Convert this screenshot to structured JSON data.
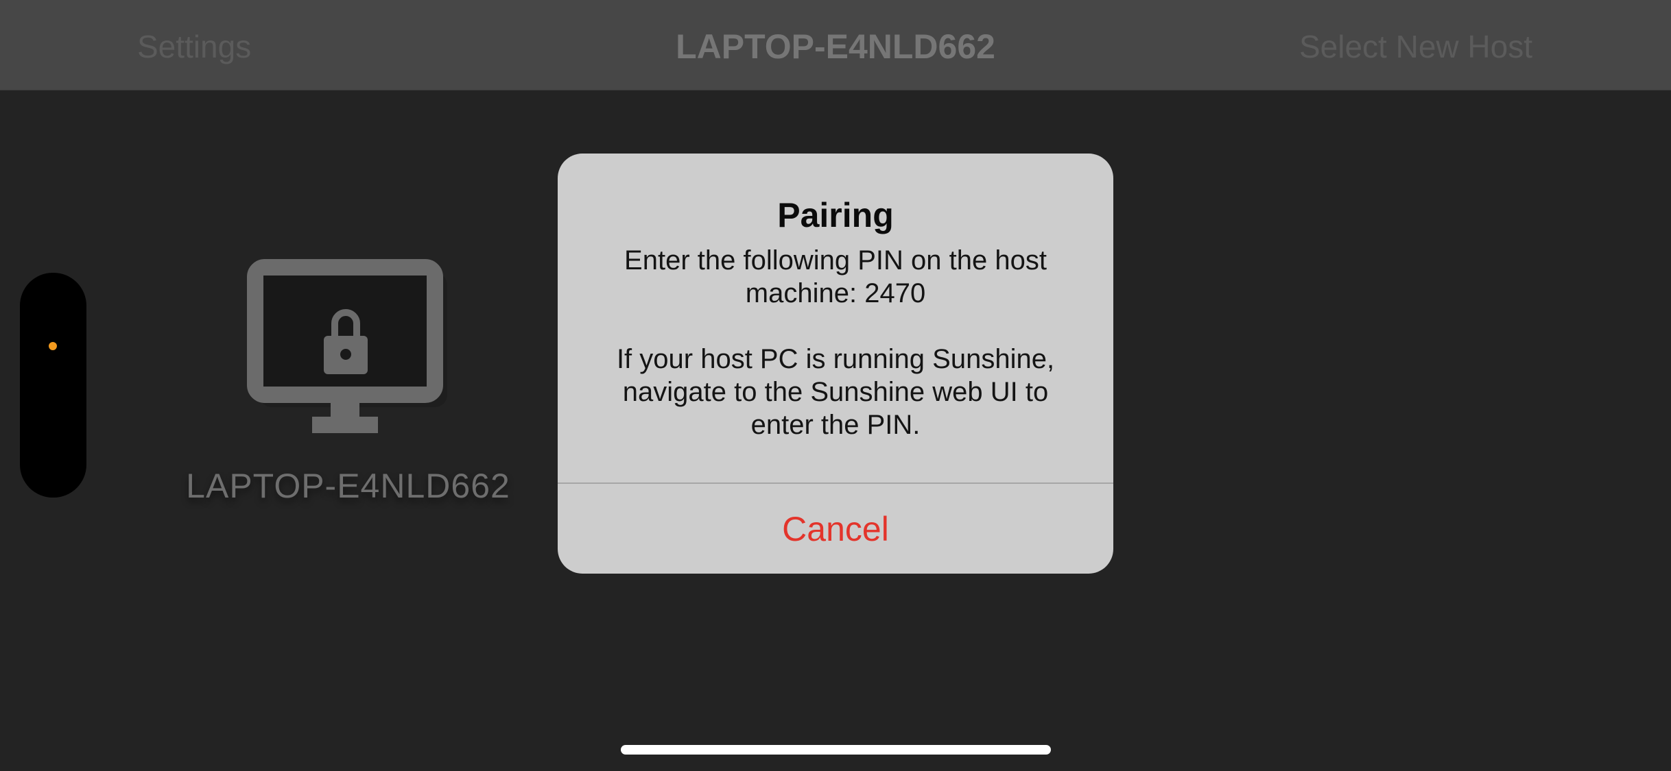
{
  "navbar": {
    "left_label": "Settings",
    "title": "LAPTOP-E4NLD662",
    "right_label": "Select New Host"
  },
  "host": {
    "name": "LAPTOP-E4NLD662",
    "icon": "locked-monitor-icon"
  },
  "alert": {
    "title": "Pairing",
    "message": "Enter the following PIN on the host machine: 2470\n\nIf your host PC is running Sunshine, navigate to the Sunshine web UI to enter the PIN.",
    "cancel_label": "Cancel"
  },
  "colors": {
    "background": "#232323",
    "navbar": "#474747",
    "alert": "#cdcdcd",
    "destructive": "#e3342b",
    "camera_indicator": "#f39a1e"
  }
}
